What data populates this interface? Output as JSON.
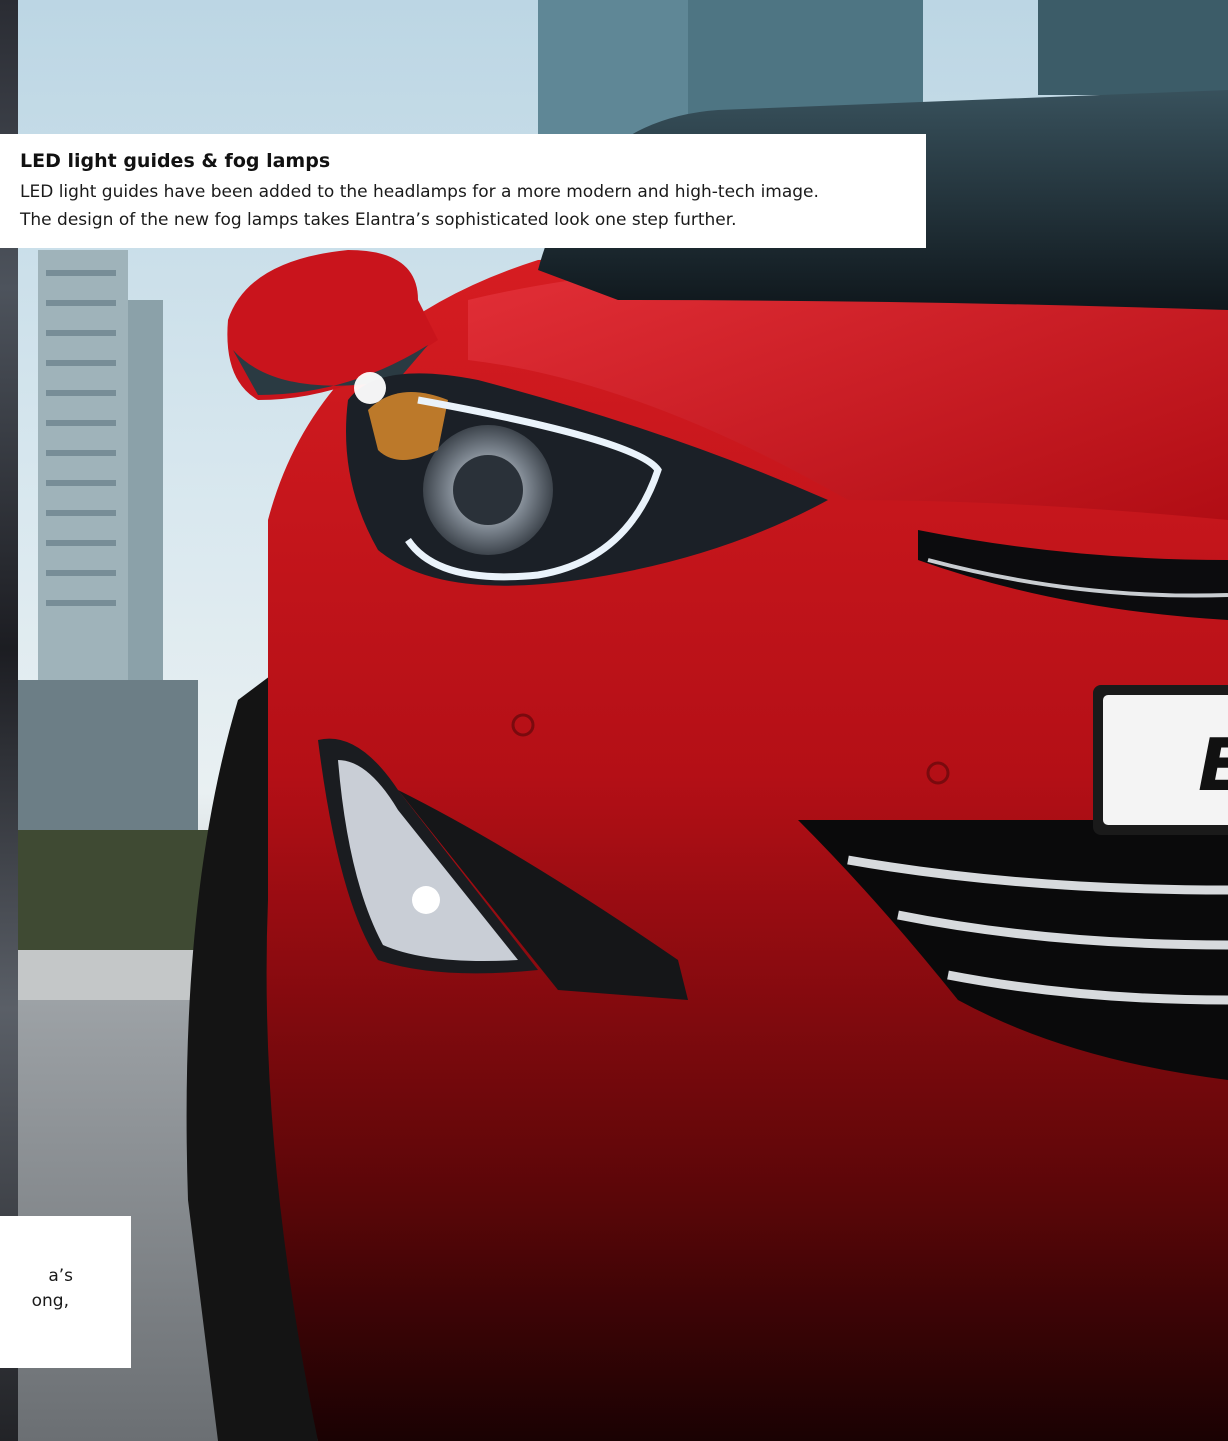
{
  "main_caption": {
    "title": "LED light guides & fog lamps",
    "line1": "LED light guides have been added to the headlamps for a more modern and high-tech image.",
    "line2": "The design of the new fog lamps takes Elantra’s sophisticated look one step further."
  },
  "partial_caption": {
    "line1": "a’s",
    "line2": "ong,"
  },
  "badge_text": "E",
  "colors": {
    "car_red": "#c8101a",
    "sky": "#cfe1ea",
    "road": "#8a8e92"
  }
}
